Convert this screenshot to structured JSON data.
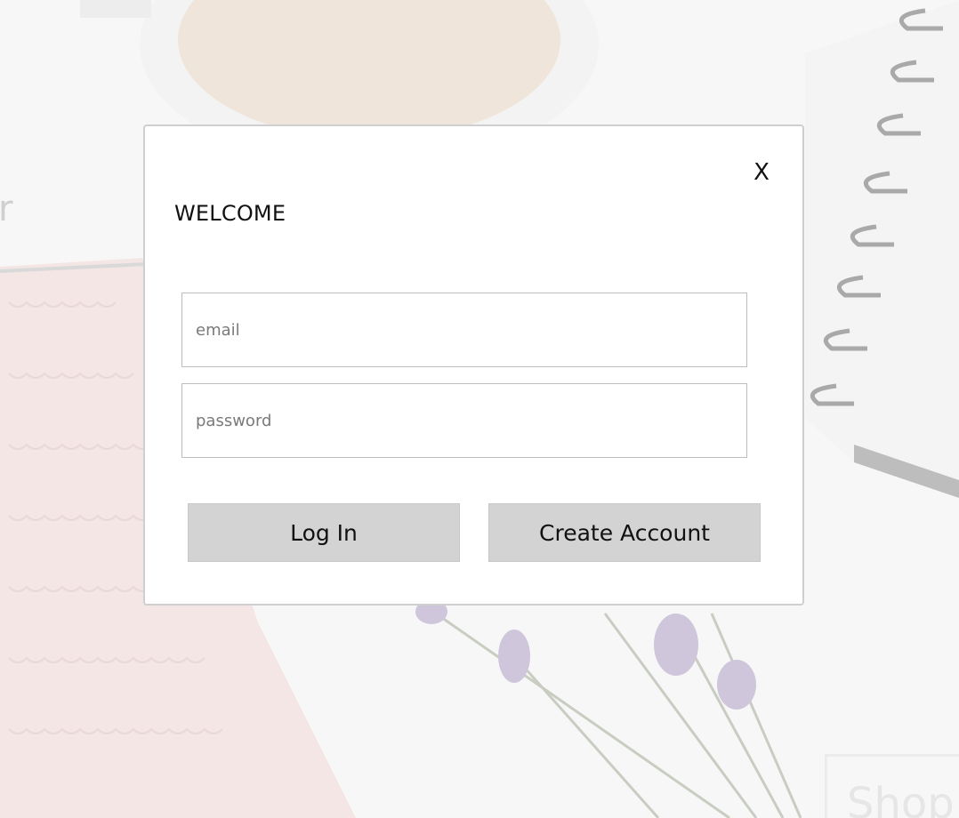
{
  "background": {
    "partial_letter": "r",
    "partial_button": "Shop"
  },
  "modal": {
    "close_label": "X",
    "title": "WELCOME",
    "email_placeholder": "email",
    "password_placeholder": "password",
    "login_label": "Log In",
    "create_account_label": "Create Account"
  }
}
